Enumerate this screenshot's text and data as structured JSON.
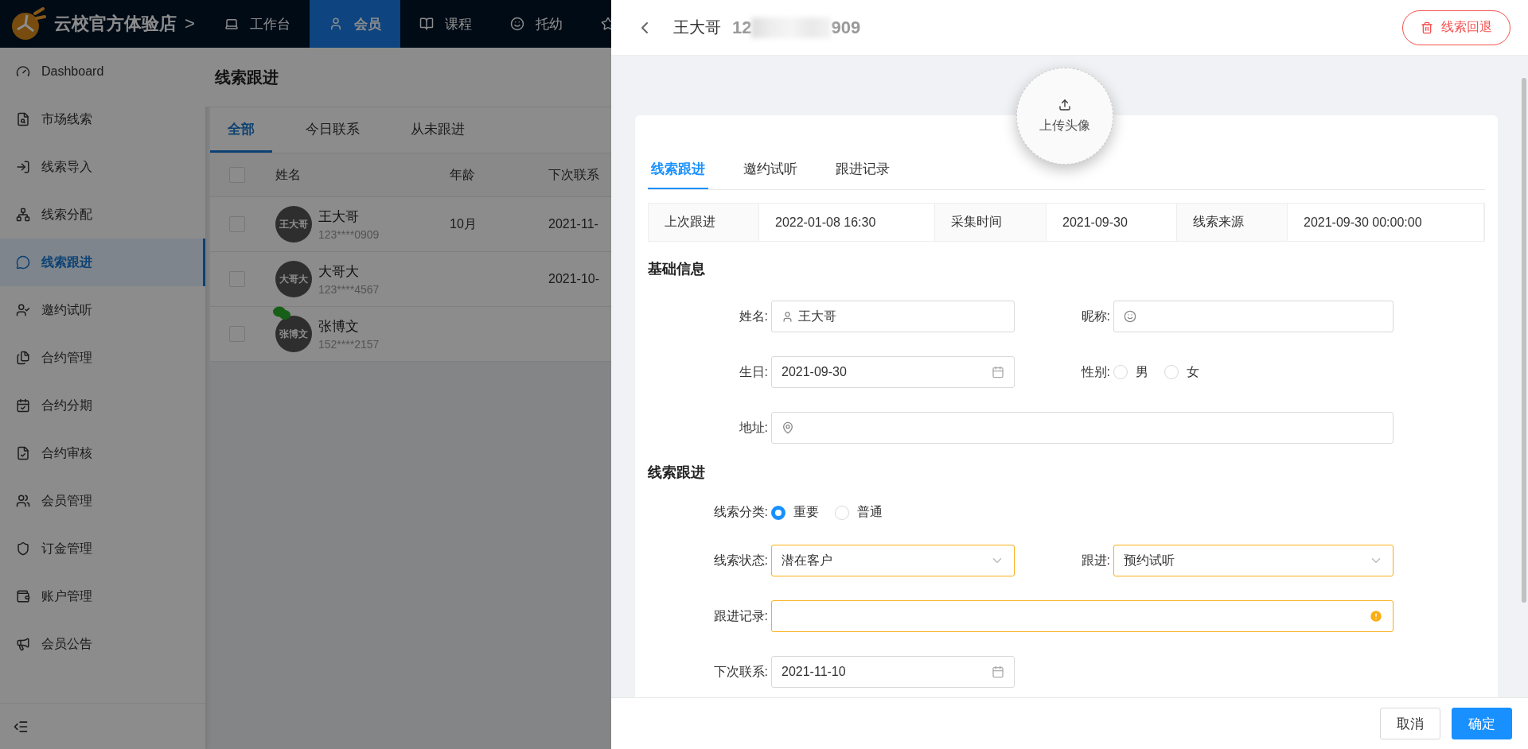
{
  "brand": {
    "name": "云校官方体验店",
    "chevron": ">"
  },
  "top_nav": [
    {
      "label": "工作台",
      "selected": false
    },
    {
      "label": "会员",
      "selected": true
    },
    {
      "label": "课程",
      "selected": false
    },
    {
      "label": "托幼",
      "selected": false
    },
    {
      "selected": false
    }
  ],
  "sidebar": {
    "items": [
      {
        "label": "Dashboard",
        "selected": false
      },
      {
        "label": "市场线索",
        "selected": false
      },
      {
        "label": "线索导入",
        "selected": false
      },
      {
        "label": "线索分配",
        "selected": false
      },
      {
        "label": "线索跟进",
        "selected": true
      },
      {
        "label": "邀约试听",
        "selected": false
      },
      {
        "label": "合约管理",
        "selected": false
      },
      {
        "label": "合约分期",
        "selected": false
      },
      {
        "label": "合约审核",
        "selected": false
      },
      {
        "label": "会员管理",
        "selected": false
      },
      {
        "label": "订金管理",
        "selected": false
      },
      {
        "label": "账户管理",
        "selected": false
      },
      {
        "label": "会员公告",
        "selected": false
      }
    ]
  },
  "page": {
    "title": "线索跟进",
    "tabs": [
      {
        "label": "全部",
        "selected": true
      },
      {
        "label": "今日联系",
        "selected": false
      },
      {
        "label": "从未跟进",
        "selected": false
      }
    ],
    "table": {
      "select_all": {
        "checked": false
      },
      "columns": [
        "姓名",
        "年龄",
        "下次联系"
      ],
      "rows": [
        {
          "checked": false,
          "avatar_text": "王大哥",
          "name": "王大哥",
          "phone": "123****0909",
          "age": "10月",
          "next_contact": "2021-11-",
          "wechat": false
        },
        {
          "checked": false,
          "avatar_text": "大哥大",
          "name": "大哥大",
          "phone": "123****4567",
          "next_contact": "2021-10-",
          "wechat": false
        },
        {
          "checked": false,
          "avatar_text": "张博文",
          "name": "张博文",
          "phone": "152****2157",
          "wechat": true
        }
      ]
    }
  },
  "drawer": {
    "name": "王大哥",
    "phone_start": "12",
    "phone_end": "909",
    "revert_button": "线索回退",
    "avatar_upload": "上传头像",
    "tabs": [
      {
        "label": "线索跟进",
        "selected": true
      },
      {
        "label": "邀约试听",
        "selected": false
      },
      {
        "label": "跟进记录",
        "selected": false
      }
    ],
    "info": [
      {
        "label": "上次跟进",
        "value": "2022-01-08 16:30"
      },
      {
        "label": "采集时间",
        "value": "2021-09-30"
      },
      {
        "label": "线索来源",
        "value": "2021-09-30 00:00:00"
      }
    ],
    "basic": {
      "title": "基础信息",
      "name": {
        "label": "姓名:",
        "value": "王大哥"
      },
      "nickname": {
        "label": "昵称:"
      },
      "birthday": {
        "label": "生日:",
        "value": "2021-09-30"
      },
      "gender": {
        "label": "性别:",
        "options": [
          {
            "label": "男",
            "selected": false
          },
          {
            "label": "女",
            "selected": false
          }
        ]
      },
      "address": {
        "label": "地址:"
      }
    },
    "follow": {
      "title": "线索跟进",
      "category": {
        "label": "线索分类:",
        "options": [
          {
            "label": "重要",
            "selected": true
          },
          {
            "label": "普通",
            "selected": false
          }
        ]
      },
      "status": {
        "label": "线索状态:",
        "value": "潜在客户",
        "warning": true
      },
      "follow_up": {
        "label": "跟进:",
        "value": "预约试听",
        "warning": true
      },
      "record": {
        "label": "跟进记录:",
        "warning": true
      },
      "next_contact": {
        "label": "下次联系:",
        "value": "2021-11-10",
        "warning": false
      }
    },
    "cancel": "取消",
    "ok": "确定"
  }
}
